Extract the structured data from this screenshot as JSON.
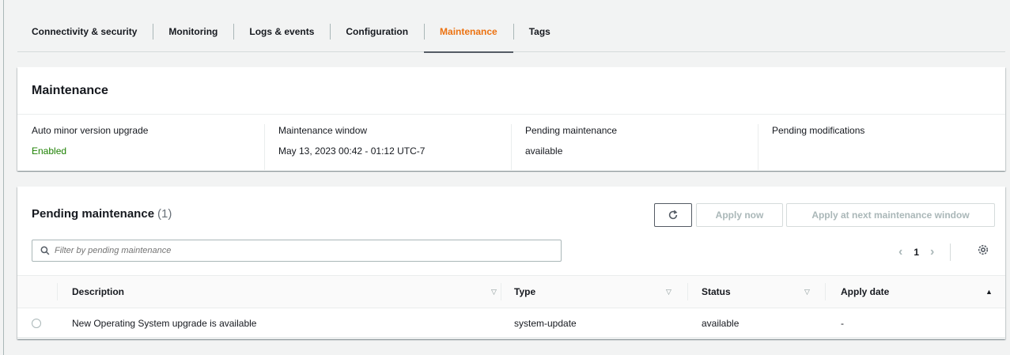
{
  "tabs": [
    {
      "label": "Connectivity & security"
    },
    {
      "label": "Monitoring"
    },
    {
      "label": "Logs & events"
    },
    {
      "label": "Configuration"
    },
    {
      "label": "Maintenance",
      "active": true
    },
    {
      "label": "Tags"
    }
  ],
  "maintenance": {
    "title": "Maintenance",
    "fields": [
      {
        "label": "Auto minor version upgrade",
        "value": "Enabled"
      },
      {
        "label": "Maintenance window",
        "value": "May 13, 2023 00:42 - 01:12 UTC-7"
      },
      {
        "label": "Pending maintenance",
        "value": "available"
      },
      {
        "label": "Pending modifications",
        "value": ""
      }
    ]
  },
  "pending": {
    "title": "Pending maintenance",
    "count": "(1)",
    "apply_now_label": "Apply now",
    "apply_next_label": "Apply at next maintenance window",
    "filter_placeholder": "Filter by pending maintenance",
    "page": "1",
    "columns": [
      "Description",
      "Type",
      "Status",
      "Apply date"
    ],
    "rows": [
      {
        "description": "New Operating System upgrade is available",
        "type": "system-update",
        "status": "available",
        "apply_date": "-"
      }
    ]
  },
  "colors": {
    "accent": "#ec7211",
    "success": "#1d8102"
  },
  "icons": [
    "refresh-icon",
    "search-icon",
    "chevron-left-icon",
    "chevron-right-icon",
    "settings-gear-icon",
    "sort-icon",
    "sort-ascending-icon"
  ]
}
